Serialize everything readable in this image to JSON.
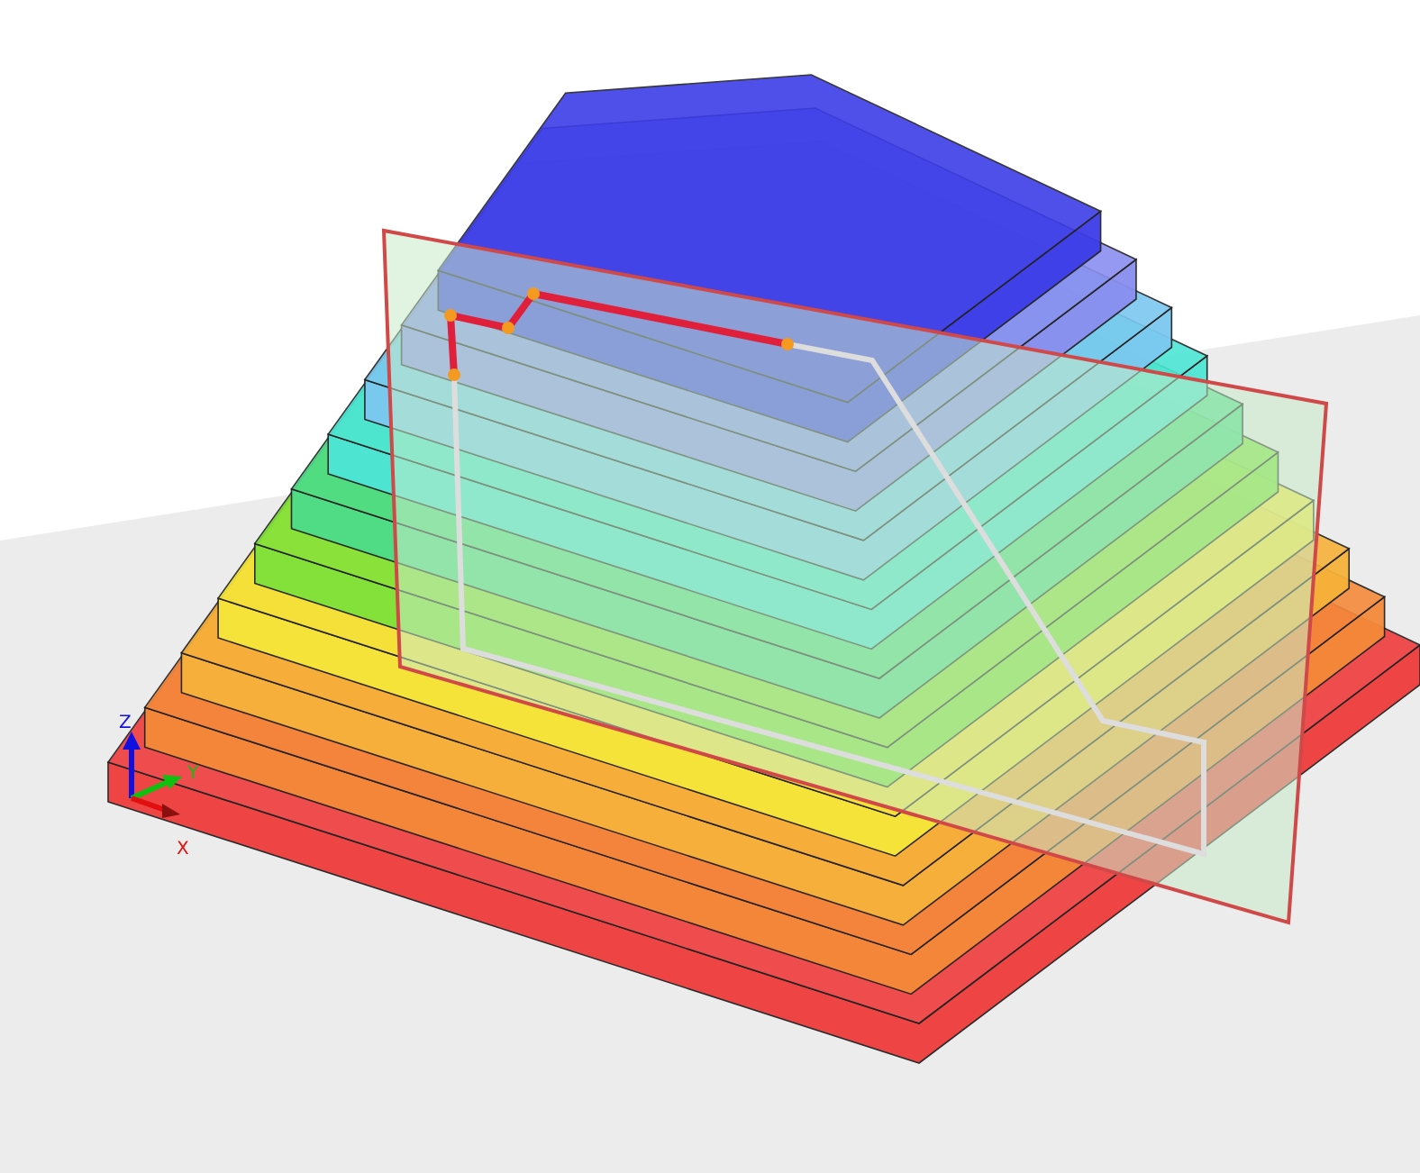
{
  "axis_triad": {
    "z_label": "Z",
    "y_label": "Y",
    "x_label": "X"
  }
}
